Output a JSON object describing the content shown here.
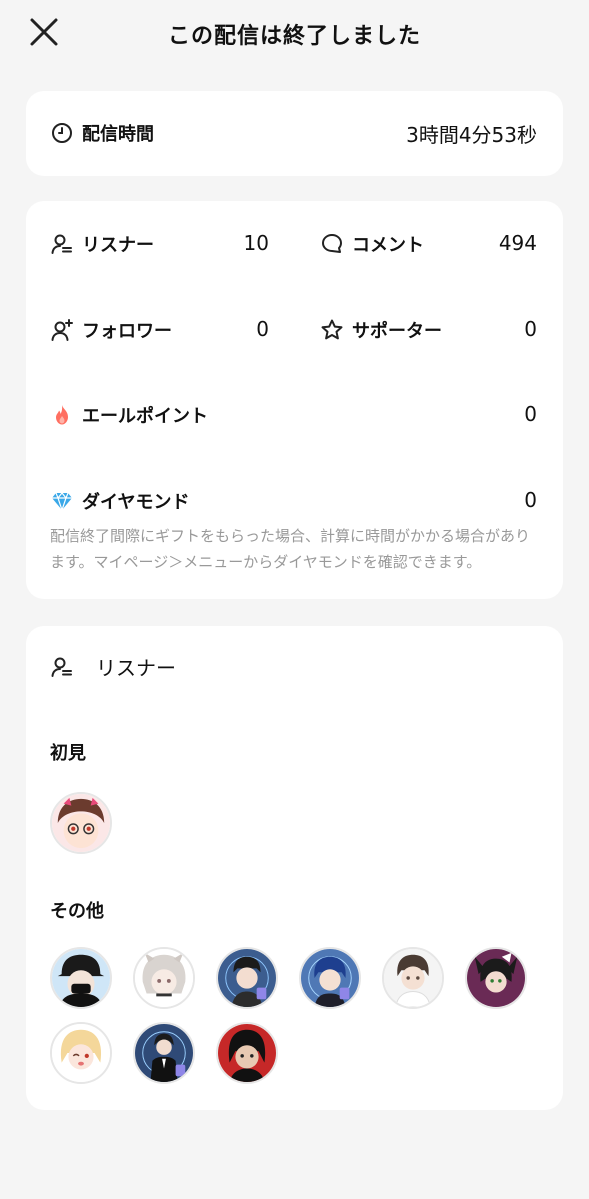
{
  "header": {
    "title": "この配信は終了しました",
    "close_icon": "close-icon"
  },
  "duration": {
    "label": "配信時間",
    "value": "3時間4分53秒",
    "icon": "clock-icon"
  },
  "stats": {
    "listeners": {
      "label": "リスナー",
      "value": "10",
      "icon": "listener-icon"
    },
    "comments": {
      "label": "コメント",
      "value": "494",
      "icon": "comment-icon"
    },
    "followers": {
      "label": "フォロワー",
      "value": "0",
      "icon": "add-follower-icon"
    },
    "supporters": {
      "label": "サポーター",
      "value": "0",
      "icon": "star-icon"
    },
    "yell_points": {
      "label": "エールポイント",
      "value": "0",
      "icon": "flame-icon",
      "color": "#ff6f61"
    },
    "diamonds": {
      "label": "ダイヤモンド",
      "value": "0",
      "icon": "diamond-icon",
      "color": "#3aa8e8"
    },
    "note": "配信終了間際にギフトをもらった場合、計算に時間がかかる場合があります。マイページ＞メニューからダイヤモンドを確認できます。"
  },
  "listeners_section": {
    "title": "リスナー",
    "icon": "listener-icon",
    "first_time": {
      "label": "初見",
      "avatars": [
        "avatar-1"
      ]
    },
    "others": {
      "label": "その他",
      "avatars": [
        "avatar-2",
        "avatar-3",
        "avatar-4",
        "avatar-5",
        "avatar-6",
        "avatar-7",
        "avatar-8",
        "avatar-9",
        "avatar-10"
      ]
    }
  },
  "colors": {
    "background": "#f5f5f5",
    "card": "#ffffff",
    "note": "#999999"
  }
}
